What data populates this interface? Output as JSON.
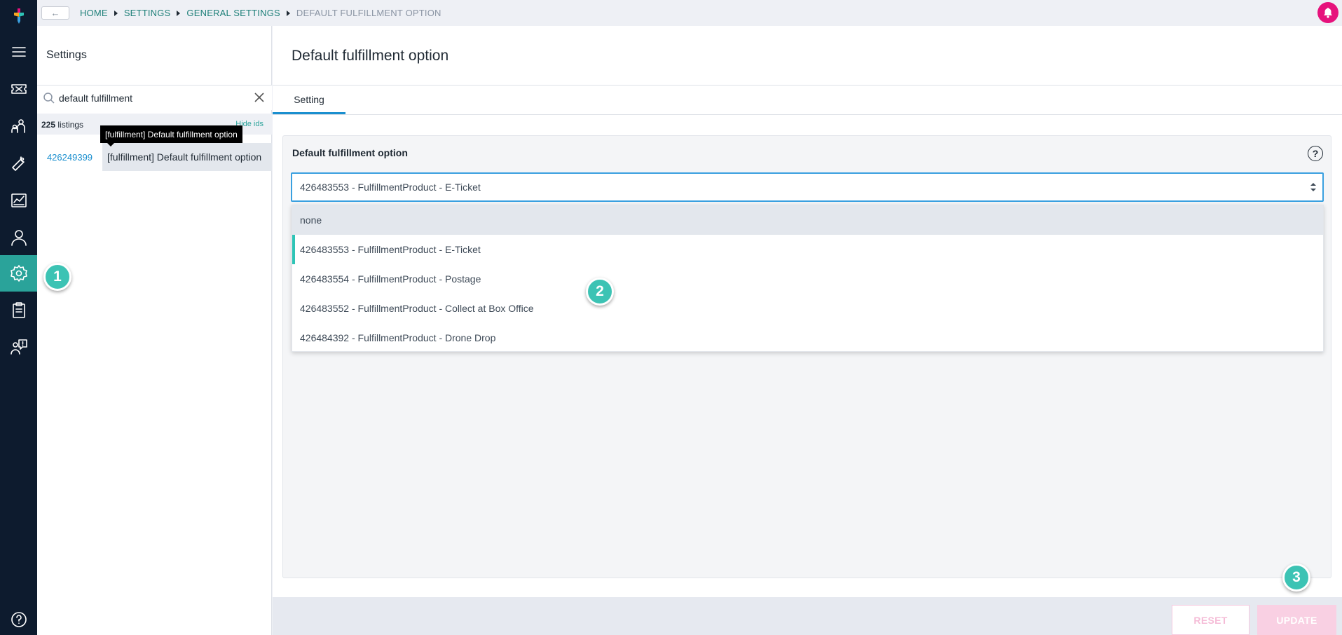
{
  "breadcrumb": {
    "items": [
      "HOME",
      "SETTINGS",
      "GENERAL SETTINGS",
      "DEFAULT FULFILLMENT OPTION"
    ]
  },
  "sidebar": {
    "title": "Settings",
    "search": {
      "value": "default fulfillment"
    },
    "listings": {
      "count": "225",
      "label": "listings",
      "hide_link": "Hide ids"
    },
    "result": {
      "id": "426249399",
      "label": "[fulfillment] Default fulfillment option"
    },
    "tooltip": "[fulfillment] Default fulfillment option"
  },
  "nav_icons": [
    "logo-icon",
    "menu-icon",
    "ticket-icon",
    "audience-icon",
    "tools-icon",
    "reports-icon",
    "user-icon",
    "settings-icon",
    "clipboard-icon",
    "support-icon",
    "help-icon"
  ],
  "main": {
    "title": "Default fulfillment option",
    "tabs": [
      {
        "label": "Setting",
        "active": true
      }
    ],
    "field": {
      "label": "Default fulfillment option",
      "selected": "426483553 - FulfillmentProduct - E-Ticket",
      "options": [
        "none",
        "426483553 - FulfillmentProduct - E-Ticket",
        "426483554 - FulfillmentProduct - Postage",
        "426483552 - FulfillmentProduct - Collect at Box Office",
        "426484392 - FulfillmentProduct - Drone Drop"
      ],
      "hovered_index": 0,
      "selected_index": 1
    },
    "help_glyph": "?"
  },
  "footer": {
    "reset_label": "RESET",
    "update_label": "UPDATE"
  },
  "markers": [
    "1",
    "2",
    "3"
  ],
  "colors": {
    "rail": "#0d1b2e",
    "accent": "#2aa39a",
    "link": "#1a8fcf",
    "brand_pink": "#e6127c",
    "marker": "#3cc3b4"
  }
}
